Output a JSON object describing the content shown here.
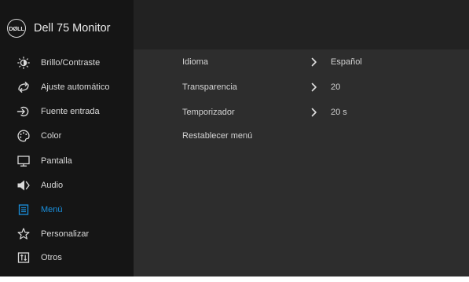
{
  "header": {
    "logo_text": "DØLL",
    "title": "Dell 75 Monitor"
  },
  "sidebar": {
    "items": [
      {
        "label": "Brillo/Contraste",
        "icon": "brightness-icon"
      },
      {
        "label": "Ajuste automático",
        "icon": "auto-adjust-icon"
      },
      {
        "label": "Fuente entrada",
        "icon": "input-source-icon"
      },
      {
        "label": "Color",
        "icon": "color-palette-icon"
      },
      {
        "label": "Pantalla",
        "icon": "display-monitor-icon"
      },
      {
        "label": "Audio",
        "icon": "speaker-icon"
      },
      {
        "label": "Menú",
        "icon": "menu-icon",
        "active": true
      },
      {
        "label": "Personalizar",
        "icon": "star-icon"
      },
      {
        "label": "Otros",
        "icon": "others-icon"
      }
    ]
  },
  "content": {
    "rows": [
      {
        "label": "Idioma",
        "value": "Español",
        "has_chevron": true
      },
      {
        "label": "Transparencia",
        "value": "20",
        "has_chevron": true
      },
      {
        "label": "Temporizador",
        "value": "20 s",
        "has_chevron": true
      },
      {
        "label": "Restablecer menú",
        "value": "",
        "has_chevron": false
      }
    ]
  },
  "colors": {
    "sidebar_bg": "#151515",
    "content_bg": "#2d2d2d",
    "header_bg": "#222222",
    "active_accent": "#1a8fdc",
    "text": "#d9d9d9"
  }
}
